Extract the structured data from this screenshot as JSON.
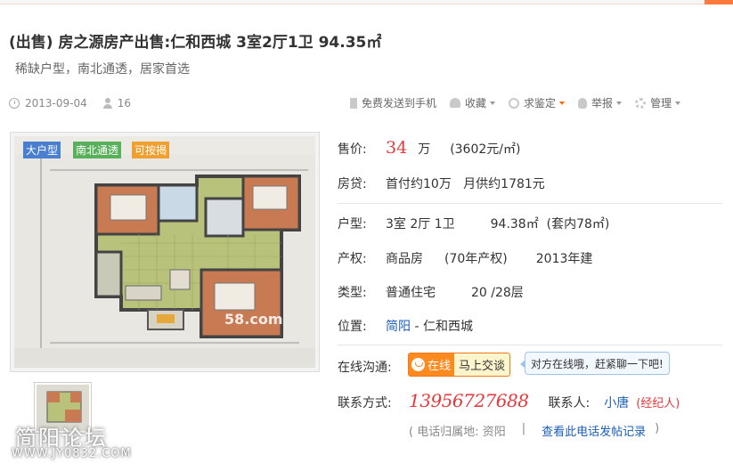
{
  "listing": {
    "title": "(出售) 房之源房产出售:仁和西城 3室2厅1卫 94.35㎡",
    "subtitle": "稀缺户型，南北通透，居家首选",
    "date": "2013-09-04",
    "views": "16"
  },
  "toolbar": {
    "send_phone": "免费发送到手机",
    "favorite": "收藏",
    "appraise": "求鉴定",
    "report": "举报",
    "manage": "管理"
  },
  "photo": {
    "tags": [
      "大户型",
      "南北通透",
      "可按揭"
    ],
    "watermark": "58.com"
  },
  "details": {
    "price_label": "售价:",
    "price_value": "34",
    "price_unit": "万",
    "unit_price": "(3602元/㎡)",
    "loan_label": "房贷:",
    "loan_value": "首付约10万   月供约1781元",
    "layout_label": "户型:",
    "layout_rooms": "3室 2厅 1卫",
    "layout_area": "94.38㎡  (套内78㎡)",
    "property_label": "产权:",
    "property_type": "商品房",
    "property_years": "(70年产权)",
    "property_built": "2013年建",
    "category_label": "类型:",
    "category_type": "普通住宅",
    "category_floor": "20 /28层",
    "location_label": "位置:",
    "location_city": "简阳",
    "location_area": " - 仁和西城",
    "online_label": "在线沟通:",
    "online_btn_left": "在线",
    "online_btn_right": "马上交谈",
    "online_tip": "对方在线哦，赶紧聊一下吧!",
    "contact_label": "联系方式:",
    "phone": "13956727688",
    "contact_person_label": "联系人:",
    "contact_person": "小唐",
    "agent_tag": "(经纪人)",
    "phone_origin": "( 电话归属地: 资阳",
    "phone_sep": "|",
    "phone_history": "查看此电话发帖记录",
    "phone_close": ")"
  },
  "forum": {
    "name": "简阳论坛",
    "url": "WWW.JY0832.COM"
  },
  "colors": {
    "price": "#e4393c",
    "link": "#1a5eb8",
    "accent": "#ff7a3a"
  }
}
